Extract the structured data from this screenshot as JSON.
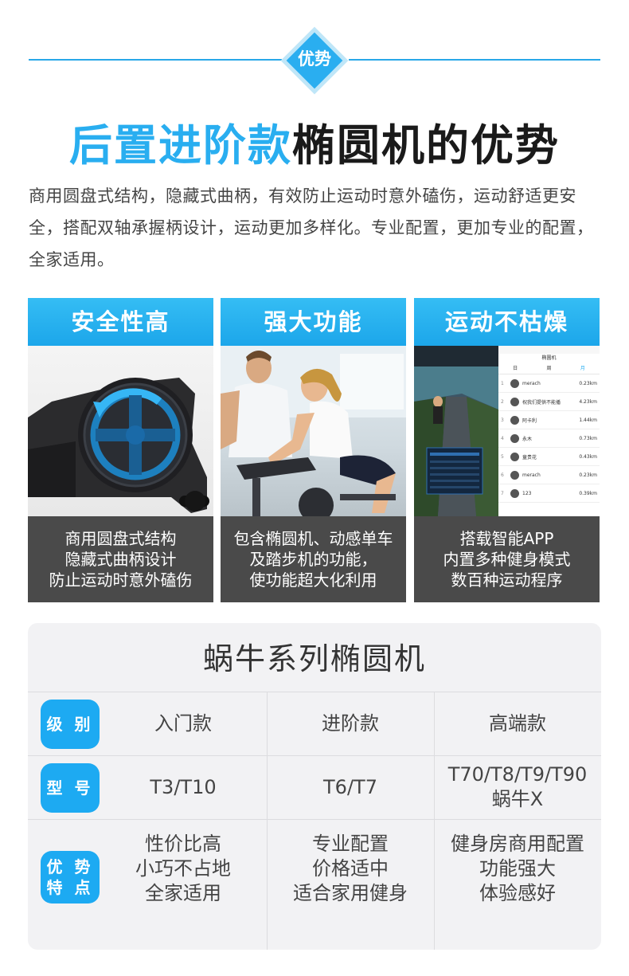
{
  "badge": "优势",
  "headline": {
    "blue": "后置进阶款",
    "dark": "椭圆机的优势"
  },
  "intro": "商用圆盘式结构，隐藏式曲柄，有效防止运动时意外磕伤，运动舒适更安全，搭配双轴承握柄设计，运动更加多样化。专业配置，更加专业的配置，全家适用。",
  "cards": [
    {
      "title": "安全性高",
      "lines": [
        "商用圆盘式结构",
        "隐藏式曲柄设计",
        "防止运动时意外磕伤"
      ]
    },
    {
      "title": "强大功能",
      "lines": [
        "包含椭圆机、动感单车",
        "及踏步机的功能，",
        "使功能超大化利用"
      ]
    },
    {
      "title": "运动不枯燥",
      "lines": [
        "搭载智能APP",
        "内置多种健身模式",
        "数百种运动程序"
      ]
    }
  ],
  "app": {
    "title": "椭圆机",
    "tabs": [
      "日",
      "周",
      "月"
    ],
    "rows": [
      {
        "rank": "1",
        "name": "merach",
        "value": "0.23km"
      },
      {
        "rank": "2",
        "name": "祝我们提供不能播",
        "value": "4.23km"
      },
      {
        "rank": "3",
        "name": "阿卡利",
        "value": "1.44km"
      },
      {
        "rank": "4",
        "name": "永木",
        "value": "0.73km"
      },
      {
        "rank": "5",
        "name": "童贵花",
        "value": "0.43km"
      },
      {
        "rank": "6",
        "name": "merach",
        "value": "0.23km"
      },
      {
        "rank": "7",
        "name": "123",
        "value": "0.39km"
      }
    ]
  },
  "table": {
    "title": "蜗牛系列椭圆机",
    "rows": [
      {
        "label": [
          "级 别"
        ],
        "cells": [
          [
            "入门款"
          ],
          [
            "进阶款"
          ],
          [
            "高端款"
          ]
        ]
      },
      {
        "label": [
          "型 号"
        ],
        "cells": [
          [
            "T3/T10"
          ],
          [
            "T6/T7"
          ],
          [
            "T70/T8/T9/T90",
            "蜗牛X"
          ]
        ]
      },
      {
        "label": [
          "优 势",
          "特 点"
        ],
        "cells": [
          [
            "性价比高",
            "小巧不占地",
            "全家适用"
          ],
          [
            "专业配置",
            "价格适中",
            "适合家用健身"
          ],
          [
            "健身房商用配置",
            "功能强大",
            "体验感好"
          ]
        ]
      }
    ]
  },
  "colors": {
    "accent": "#29aef0",
    "card_bg": "#4a4a4a",
    "table_bg": "#f2f2f4"
  }
}
